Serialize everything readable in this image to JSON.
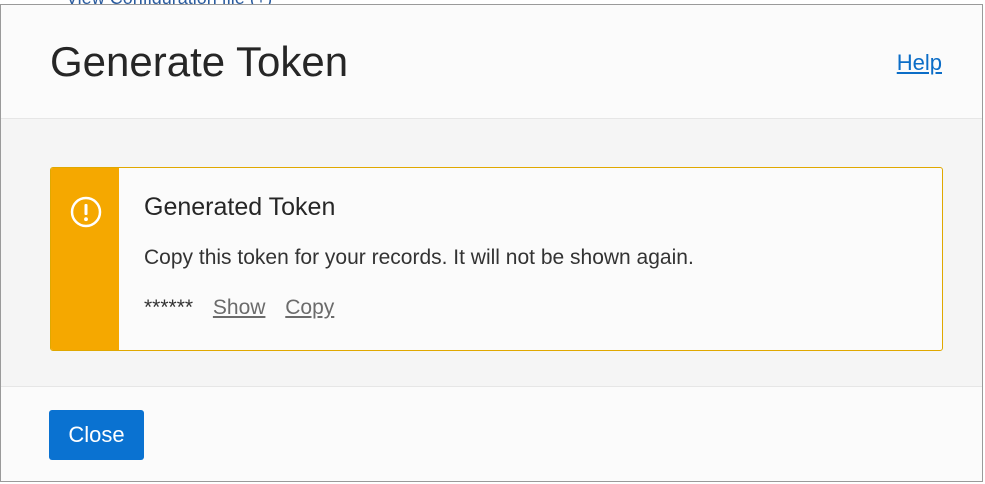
{
  "dialog": {
    "title": "Generate Token",
    "help_label": "Help"
  },
  "message": {
    "severity": "warning",
    "icon": "warning-circle-icon",
    "accent_color": "#f5a800",
    "title": "Generated Token",
    "text": "Copy this token for your records. It will not be shown again.",
    "token_masked": "******",
    "show_label": "Show",
    "copy_label": "Copy"
  },
  "footer": {
    "close_label": "Close",
    "button_color": "#0a72d1"
  }
}
